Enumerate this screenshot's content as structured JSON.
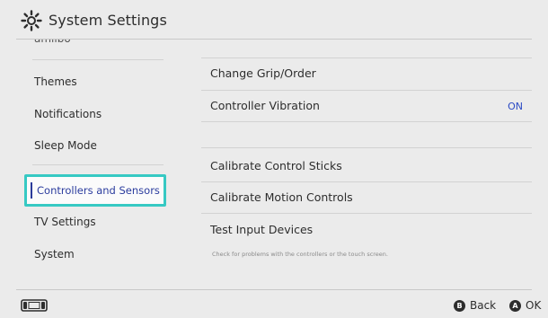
{
  "header": {
    "title": "System Settings",
    "icon": "gear-icon"
  },
  "sidebar": {
    "cut_item": "amiibo",
    "items": [
      {
        "label": "Themes"
      },
      {
        "label": "Notifications"
      },
      {
        "label": "Sleep Mode"
      },
      {
        "label": "Controllers and Sensors",
        "selected": true
      },
      {
        "label": "TV Settings"
      },
      {
        "label": "System"
      }
    ]
  },
  "main": {
    "rows": [
      {
        "label": "Change Grip/Order"
      },
      {
        "label": "Controller Vibration",
        "value": "ON"
      },
      {
        "label": "Calibrate Control Sticks"
      },
      {
        "label": "Calibrate Motion Controls"
      },
      {
        "label": "Test Input Devices",
        "hint": "Check for problems with the controllers or the touch screen."
      }
    ]
  },
  "footer": {
    "console_icon": "console-icon",
    "back": {
      "button": "B",
      "label": "Back"
    },
    "ok": {
      "button": "A",
      "label": "OK"
    }
  },
  "colors": {
    "background": "#ebebeb",
    "selection_border": "#36c9c3",
    "selection_text": "#2b3c9e",
    "value_on": "#2b4ac4"
  }
}
